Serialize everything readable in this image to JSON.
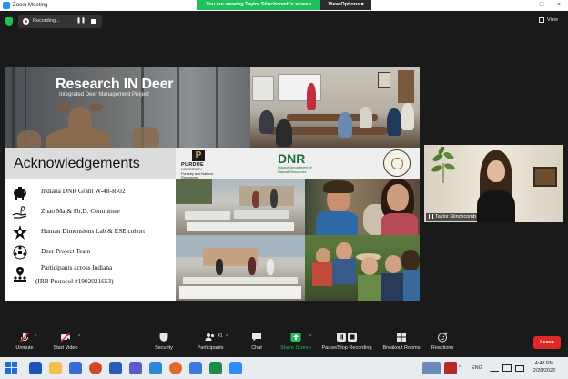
{
  "window": {
    "title": "Zoom Meeting",
    "share_banner": "You are viewing Taylor Stinchcomb's screen",
    "view_options": "View Options",
    "minimize": "–",
    "maximize": "□",
    "close": "×"
  },
  "recording": {
    "label": "Recording...",
    "pause_glyph": "❚❚"
  },
  "view_button": {
    "label": "View"
  },
  "slide": {
    "banner_title": "Research IN Deer",
    "banner_subtitle": "Integrated Deer Management Project",
    "ack_title": "Acknowledgements",
    "items": [
      {
        "text": "Indiana DNR Grant W-48-R-02",
        "icon": "piggy-bank-icon"
      },
      {
        "text": "Zhao Ma & Ph.D. Committee",
        "icon": "helping-hand-icon"
      },
      {
        "text": "Human Dimensions Lab & ESE cohort",
        "icon": "network-star-icon"
      },
      {
        "text": "Deer Project Team",
        "icon": "team-circle-icon"
      },
      {
        "text": "Participants across Indiana",
        "icon": "people-location-icon"
      },
      {
        "text": "(IRB Protocol #1902021653)",
        "icon": ""
      }
    ],
    "purdue": {
      "mark": "P",
      "name": "PURDUE",
      "sub_1": "UNIVERSITY.",
      "sub_2": "Forestry and Natural Resources"
    },
    "dnr": {
      "name": "DNR",
      "sub": "Indiana Department of Natural Resources"
    }
  },
  "participant": {
    "name": "Taylor Stinchcomb"
  },
  "toolbar": {
    "unmute": "Unmute",
    "start_video": "Start Video",
    "security": "Security",
    "participants": "Participants",
    "participants_count": "41",
    "chat": "Chat",
    "share_screen": "Share Screen",
    "record": "Pause/Stop Recording",
    "breakout": "Breakout Rooms",
    "reactions": "Reactions",
    "leave": "Leave",
    "caret": "^"
  },
  "taskbar": {
    "lang": "ENG",
    "time": "4:48 PM",
    "date": "2/28/2022",
    "tray_chevron": "^"
  },
  "colors": {
    "zoom_green": "#20c05c",
    "leave_red": "#e02828",
    "zoom_blue": "#2d8cff",
    "dnr_green": "#19713a"
  }
}
